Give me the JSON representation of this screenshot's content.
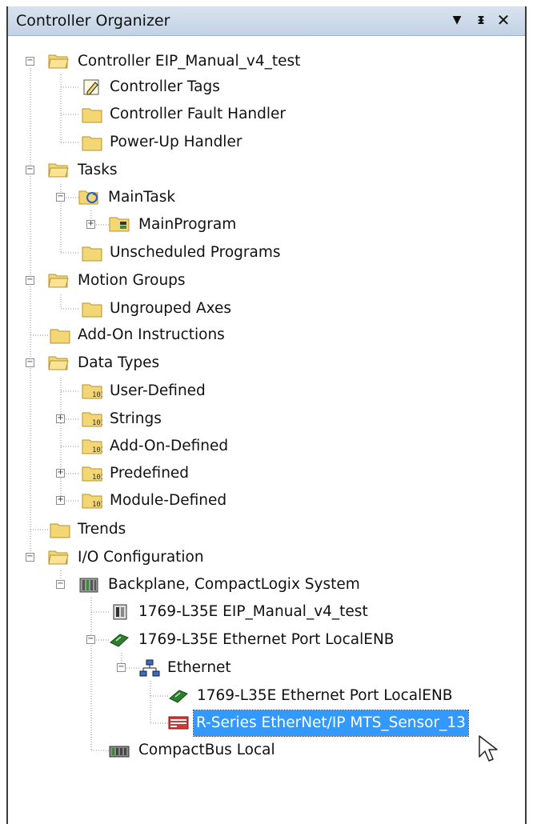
{
  "panel": {
    "title": "Controller Organizer",
    "dropdown_icon": "dropdown-arrow-icon",
    "pin_icon": "pin-icon",
    "close_icon": "close-icon"
  },
  "tree": {
    "controller": {
      "label": "Controller EIP_Manual_v4_test",
      "icon": "folder-open-icon",
      "expander": "−"
    },
    "controller_tags": {
      "label": "Controller Tags",
      "icon": "tags-icon"
    },
    "fault_handler": {
      "label": "Controller Fault Handler",
      "icon": "folder-icon"
    },
    "powerup_handler": {
      "label": "Power-Up Handler",
      "icon": "folder-icon"
    },
    "tasks": {
      "label": "Tasks",
      "icon": "folder-open-icon",
      "expander": "−"
    },
    "main_task": {
      "label": "MainTask",
      "icon": "task-folder-icon",
      "expander": "−"
    },
    "main_program": {
      "label": "MainProgram",
      "icon": "program-icon",
      "expander": "+"
    },
    "unscheduled": {
      "label": "Unscheduled Programs",
      "icon": "folder-icon"
    },
    "motion_groups": {
      "label": "Motion Groups",
      "icon": "folder-open-icon",
      "expander": "−"
    },
    "ungrouped_axes": {
      "label": "Ungrouped Axes",
      "icon": "folder-icon"
    },
    "aoi": {
      "label": "Add-On Instructions",
      "icon": "folder-icon"
    },
    "data_types": {
      "label": "Data Types",
      "icon": "folder-open-icon",
      "expander": "−"
    },
    "user_defined": {
      "label": "User-Defined",
      "icon": "datatype-folder-icon"
    },
    "strings": {
      "label": "Strings",
      "icon": "datatype-folder-icon",
      "expander": "+"
    },
    "aod": {
      "label": "Add-On-Defined",
      "icon": "datatype-folder-icon"
    },
    "predefined": {
      "label": "Predefined",
      "icon": "datatype-folder-icon",
      "expander": "+"
    },
    "module_defined": {
      "label": "Module-Defined",
      "icon": "datatype-folder-icon",
      "expander": "+"
    },
    "trends": {
      "label": "Trends",
      "icon": "folder-icon"
    },
    "io_config": {
      "label": "I/O Configuration",
      "icon": "folder-open-icon",
      "expander": "−"
    },
    "backplane": {
      "label": "Backplane, CompactLogix System",
      "icon": "backplane-icon",
      "expander": "−"
    },
    "l35e": {
      "label": "1769-L35E EIP_Manual_v4_test",
      "icon": "controller-module-icon"
    },
    "eth_port": {
      "label": "1769-L35E Ethernet Port LocalENB",
      "icon": "ethernet-module-icon",
      "expander": "−"
    },
    "ethernet": {
      "label": "Ethernet",
      "icon": "network-icon",
      "expander": "−"
    },
    "eth_port_2": {
      "label": "1769-L35E Ethernet Port LocalENB",
      "icon": "ethernet-module-icon"
    },
    "rseries": {
      "label": "R-Series EtherNet/IP MTS_Sensor_13",
      "icon": "sensor-module-icon",
      "selected": true
    },
    "compactbus": {
      "label": "CompactBus Local",
      "icon": "compactbus-icon"
    }
  },
  "colors": {
    "selection": "#3399ff",
    "folder": "#f3d774",
    "titlebar": "#c9d8ea"
  },
  "cursor_icon": "mouse-pointer-icon"
}
